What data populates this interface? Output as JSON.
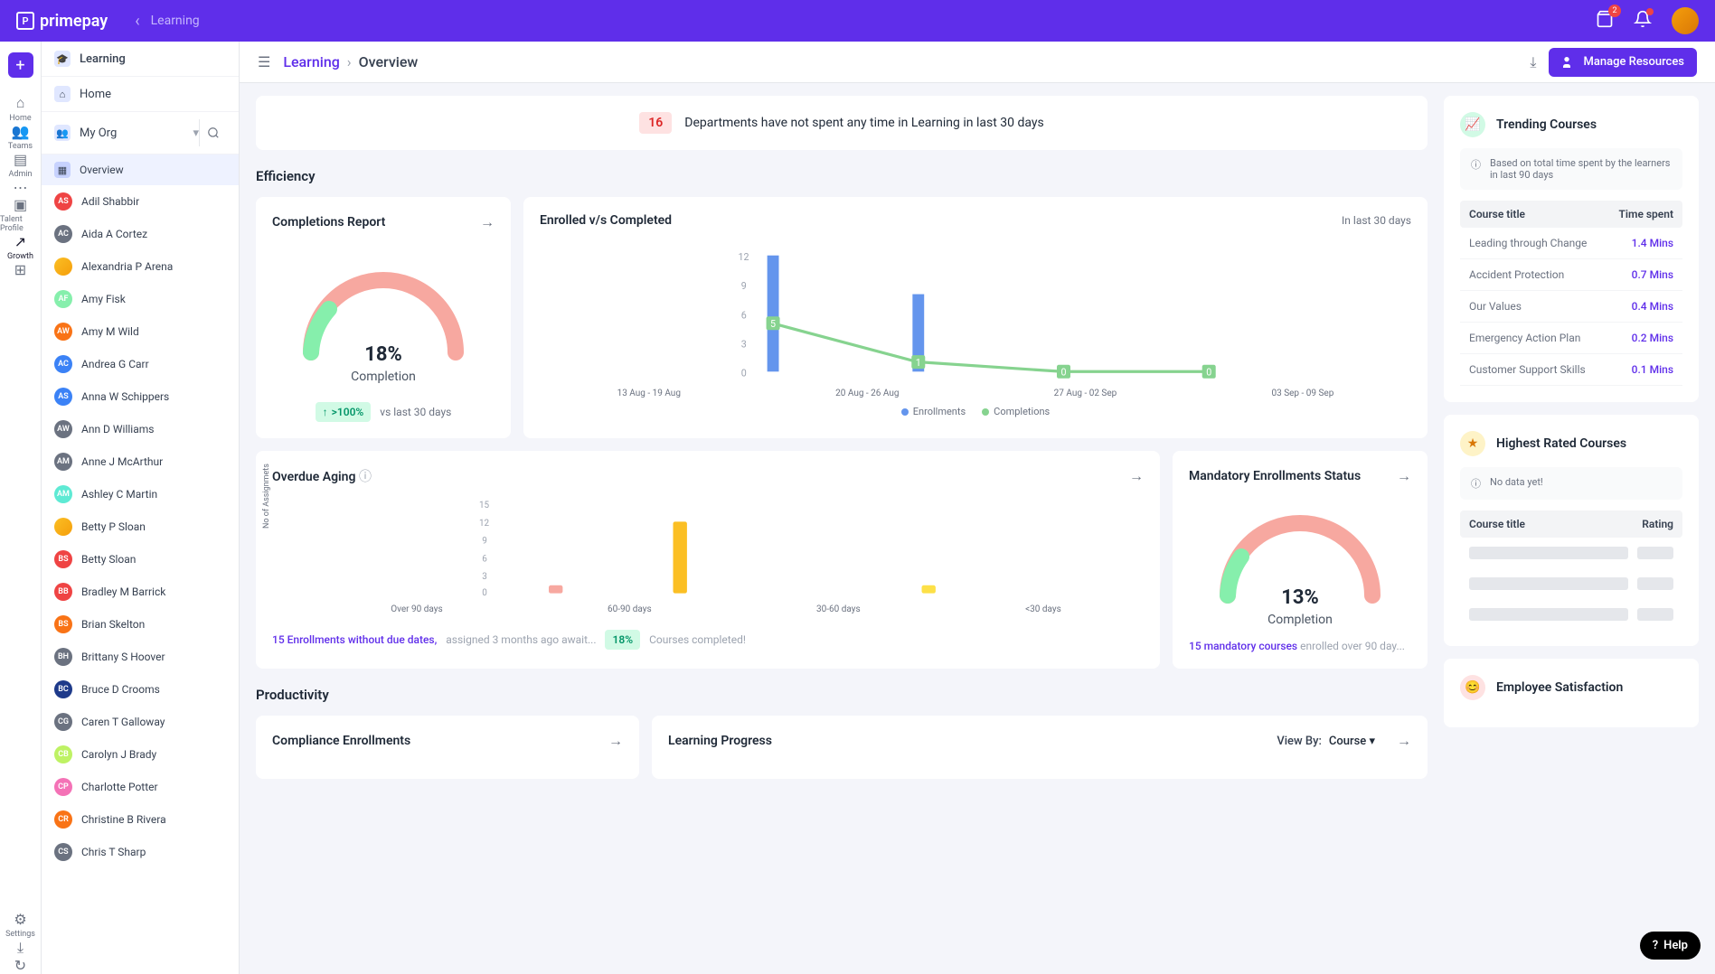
{
  "topbar": {
    "logo": "primepay",
    "back_label": "Learning",
    "cart_badge": "2"
  },
  "rail": {
    "items": [
      {
        "label": "Home",
        "icon": "⌂"
      },
      {
        "label": "Teams",
        "icon": "👥"
      },
      {
        "label": "Admin",
        "icon": "▤"
      },
      {
        "label": "",
        "icon": "⋯"
      },
      {
        "label": "Talent Profile",
        "icon": "▣"
      },
      {
        "label": "Growth",
        "icon": "↗"
      },
      {
        "label": "",
        "icon": "⊞"
      }
    ],
    "bottom": [
      {
        "label": "Settings",
        "icon": "⚙"
      },
      {
        "label": "",
        "icon": "⤓"
      },
      {
        "label": "",
        "icon": "↻"
      }
    ]
  },
  "sidepanel": {
    "learning": "Learning",
    "home": "Home",
    "myorg": "My Org",
    "overview": "Overview",
    "people": [
      {
        "initials": "AS",
        "name": "Adil Shabbir",
        "color": "#ef4444"
      },
      {
        "initials": "AC",
        "name": "Aida A Cortez",
        "color": "#6b7280"
      },
      {
        "initials": "",
        "name": "Alexandria P Arena",
        "color": "",
        "img": true
      },
      {
        "initials": "AF",
        "name": "Amy Fisk",
        "color": "#86efac"
      },
      {
        "initials": "AW",
        "name": "Amy M Wild",
        "color": "#f97316"
      },
      {
        "initials": "AC",
        "name": "Andrea G Carr",
        "color": "#3b82f6"
      },
      {
        "initials": "AS",
        "name": "Anna W Schippers",
        "color": "#3b82f6"
      },
      {
        "initials": "AW",
        "name": "Ann D Williams",
        "color": "#6b7280"
      },
      {
        "initials": "AM",
        "name": "Anne J McArthur",
        "color": "#6b7280"
      },
      {
        "initials": "AM",
        "name": "Ashley C Martin",
        "color": "#5eead4"
      },
      {
        "initials": "",
        "name": "Betty P Sloan",
        "color": "",
        "img": true
      },
      {
        "initials": "BS",
        "name": "Betty Sloan",
        "color": "#ef4444"
      },
      {
        "initials": "BB",
        "name": "Bradley M Barrick",
        "color": "#ef4444"
      },
      {
        "initials": "BS",
        "name": "Brian Skelton",
        "color": "#f97316"
      },
      {
        "initials": "BH",
        "name": "Brittany S Hoover",
        "color": "#6b7280"
      },
      {
        "initials": "BC",
        "name": "Bruce D Crooms",
        "color": "#1e3a8a"
      },
      {
        "initials": "CG",
        "name": "Caren T Galloway",
        "color": "#6b7280"
      },
      {
        "initials": "CB",
        "name": "Carolyn J Brady",
        "color": "#bef264"
      },
      {
        "initials": "CP",
        "name": "Charlotte Potter",
        "color": "#f472b6"
      },
      {
        "initials": "CR",
        "name": "Christine B Rivera",
        "color": "#f97316"
      },
      {
        "initials": "CS",
        "name": "Chris T Sharp",
        "color": "#6b7280"
      }
    ]
  },
  "breadcrumb": {
    "link": "Learning",
    "current": "Overview"
  },
  "buttons": {
    "manage": "Manage Resources"
  },
  "banner": {
    "num": "16",
    "text": "Departments have not spent any time in Learning in last 30 days"
  },
  "sections": {
    "efficiency": "Efficiency",
    "productivity": "Productivity"
  },
  "completions": {
    "title": "Completions Report",
    "pct": "18%",
    "label": "Completion",
    "trend": ">100%",
    "trend_label": "vs last 30 days"
  },
  "enrolled": {
    "title": "Enrolled v/s Completed",
    "range": "In last 30 days",
    "legend": {
      "a": "Enrollments",
      "b": "Completions"
    },
    "x": [
      "13 Aug - 19 Aug",
      "20 Aug - 26 Aug",
      "27 Aug - 02 Sep",
      "03 Sep - 09 Sep"
    ]
  },
  "overdue": {
    "title": "Overdue Aging",
    "ylabel": "No of Assignmets",
    "x": [
      "Over 90 days",
      "60-90 days",
      "30-60 days",
      "<30 days"
    ],
    "foot_link": "15 Enrollments without due dates,",
    "foot_gray": "assigned 3 months ago await...",
    "foot_badge": "18%",
    "foot_right": "Courses completed!"
  },
  "mandatory": {
    "title": "Mandatory Enrollments Status",
    "pct": "13%",
    "label": "Completion",
    "foot_link": "15 mandatory courses",
    "foot_gray": "enrolled over 90 day..."
  },
  "compliance": {
    "title": "Compliance Enrollments"
  },
  "progress": {
    "title": "Learning Progress",
    "viewby_lbl": "View By:",
    "viewby_val": "Course"
  },
  "trending": {
    "title": "Trending Courses",
    "info": "Based on total time spent by the learners in last 90 days",
    "col1": "Course title",
    "col2": "Time spent",
    "rows": [
      {
        "name": "Leading through Change",
        "time": "1.4 Mins"
      },
      {
        "name": "Accident Protection",
        "time": "0.7 Mins"
      },
      {
        "name": "Our Values",
        "time": "0.4 Mins"
      },
      {
        "name": "Emergency Action Plan",
        "time": "0.2 Mins"
      },
      {
        "name": "Customer Support Skills",
        "time": "0.1 Mins"
      }
    ]
  },
  "rated": {
    "title": "Highest Rated Courses",
    "info": "No data yet!",
    "col1": "Course title",
    "col2": "Rating"
  },
  "satisfaction": {
    "title": "Employee Satisfaction"
  },
  "help": "Help",
  "chart_data": [
    {
      "type": "gauge",
      "title": "Completions Report",
      "value": 18,
      "unit": "%",
      "range": [
        0,
        100
      ],
      "fill_color": "#86efac",
      "remainder_color": "#f7a8a0"
    },
    {
      "type": "bar+line",
      "title": "Enrolled v/s Completed",
      "categories": [
        "13 Aug - 19 Aug",
        "20 Aug - 26 Aug",
        "27 Aug - 02 Sep",
        "03 Sep - 09 Sep"
      ],
      "series": [
        {
          "name": "Enrollments",
          "type": "bar",
          "values": [
            12,
            8,
            0,
            0
          ],
          "color": "#6495ed"
        },
        {
          "name": "Completions",
          "type": "line",
          "values": [
            5,
            1,
            0,
            0
          ],
          "color": "#86d38f"
        }
      ],
      "ylim": [
        0,
        12
      ],
      "yticks": [
        0,
        3,
        6,
        9,
        12
      ]
    },
    {
      "type": "bar",
      "title": "Overdue Aging",
      "categories": [
        "Over 90 days",
        "60-90 days",
        "30-60 days",
        "<30 days"
      ],
      "values": [
        1,
        12,
        0,
        1
      ],
      "colors": [
        "#f7a8a0",
        "#fbbf24",
        "#fbbf24",
        "#fde047"
      ],
      "ylabel": "No of Assignmets",
      "ylim": [
        0,
        15
      ],
      "yticks": [
        0,
        3,
        6,
        9,
        12,
        15
      ]
    },
    {
      "type": "gauge",
      "title": "Mandatory Enrollments Status",
      "value": 13,
      "unit": "%",
      "range": [
        0,
        100
      ],
      "fill_color": "#86efac",
      "remainder_color": "#f7a8a0"
    }
  ]
}
